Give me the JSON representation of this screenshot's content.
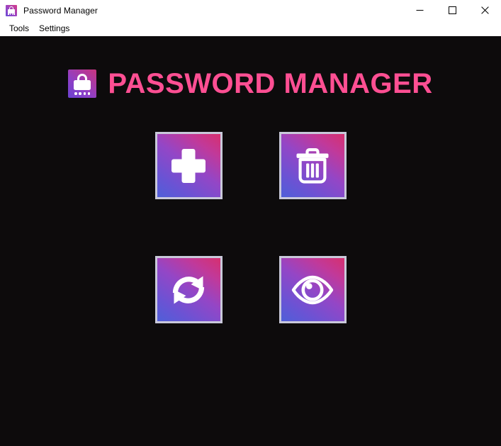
{
  "window": {
    "title": "Password Manager",
    "icon": "padlock-icon",
    "controls": [
      {
        "name": "minimize",
        "glyph": "minimize-icon"
      },
      {
        "name": "maximize",
        "glyph": "maximize-icon"
      },
      {
        "name": "close",
        "glyph": "close-icon"
      }
    ]
  },
  "menubar": {
    "items": [
      {
        "label": "Tools"
      },
      {
        "label": "Settings"
      }
    ]
  },
  "header": {
    "logo_icon": "padlock-logo-icon",
    "title": "PASSWORD MANAGER"
  },
  "actions": {
    "buttons": [
      {
        "name": "add-password-button",
        "icon": "plus-icon"
      },
      {
        "name": "delete-password-button",
        "icon": "trash-icon"
      },
      {
        "name": "refresh-button",
        "icon": "refresh-icon"
      },
      {
        "name": "view-password-button",
        "icon": "eye-icon"
      }
    ]
  },
  "colors": {
    "background": "#0d0b0c",
    "title_pink": "#ff4f93",
    "gradient_start": "#4f5fd8",
    "gradient_end": "#d6306f",
    "button_border": "#c9c9da",
    "titlebar_background": "#ffffff",
    "text": "#000000"
  }
}
